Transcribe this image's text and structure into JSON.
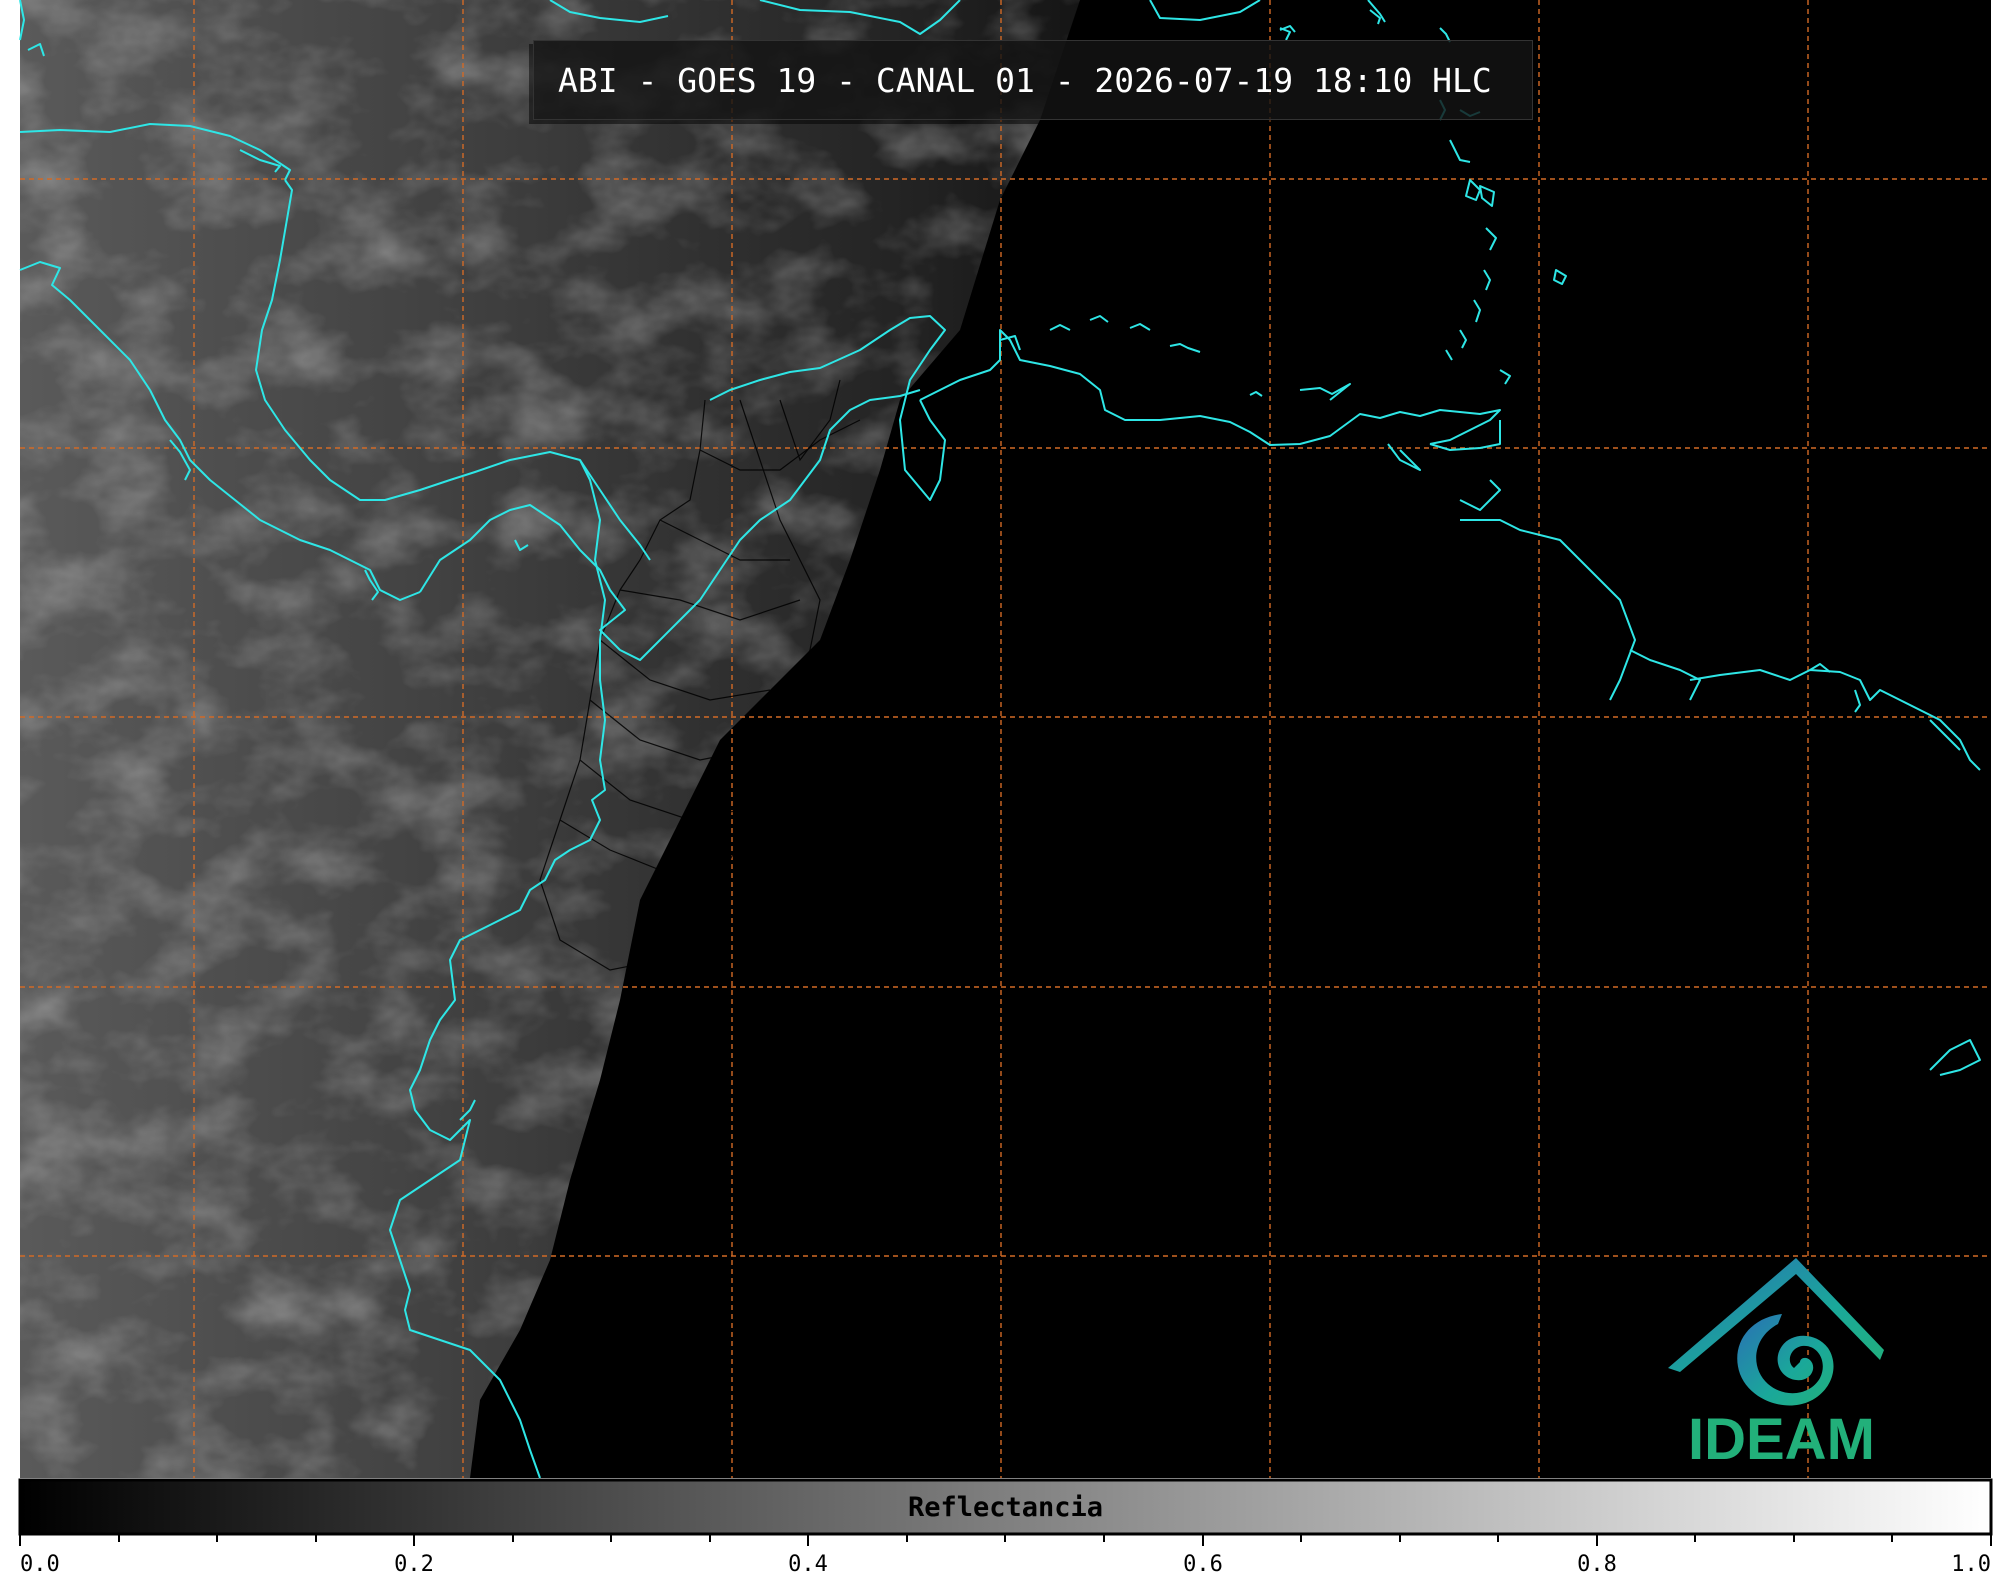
{
  "title": "ABI - GOES 19 - CANAL 01 - 2026-07-19 18:10 HLC",
  "colorbar": {
    "label": "Reflectancia",
    "ticks": [
      "0.0",
      "0.2",
      "0.4",
      "0.6",
      "0.8",
      "1.0"
    ],
    "range": [
      0,
      1
    ]
  },
  "logo": {
    "text": "IDEAM",
    "colors": {
      "blue": "#2a6fb5",
      "teal": "#1aa89a",
      "green": "#22b07a"
    }
  },
  "colors": {
    "coastline": "#2ee6e6",
    "graticule": "#d26a26",
    "borders": "#000000",
    "night": "#000000"
  }
}
